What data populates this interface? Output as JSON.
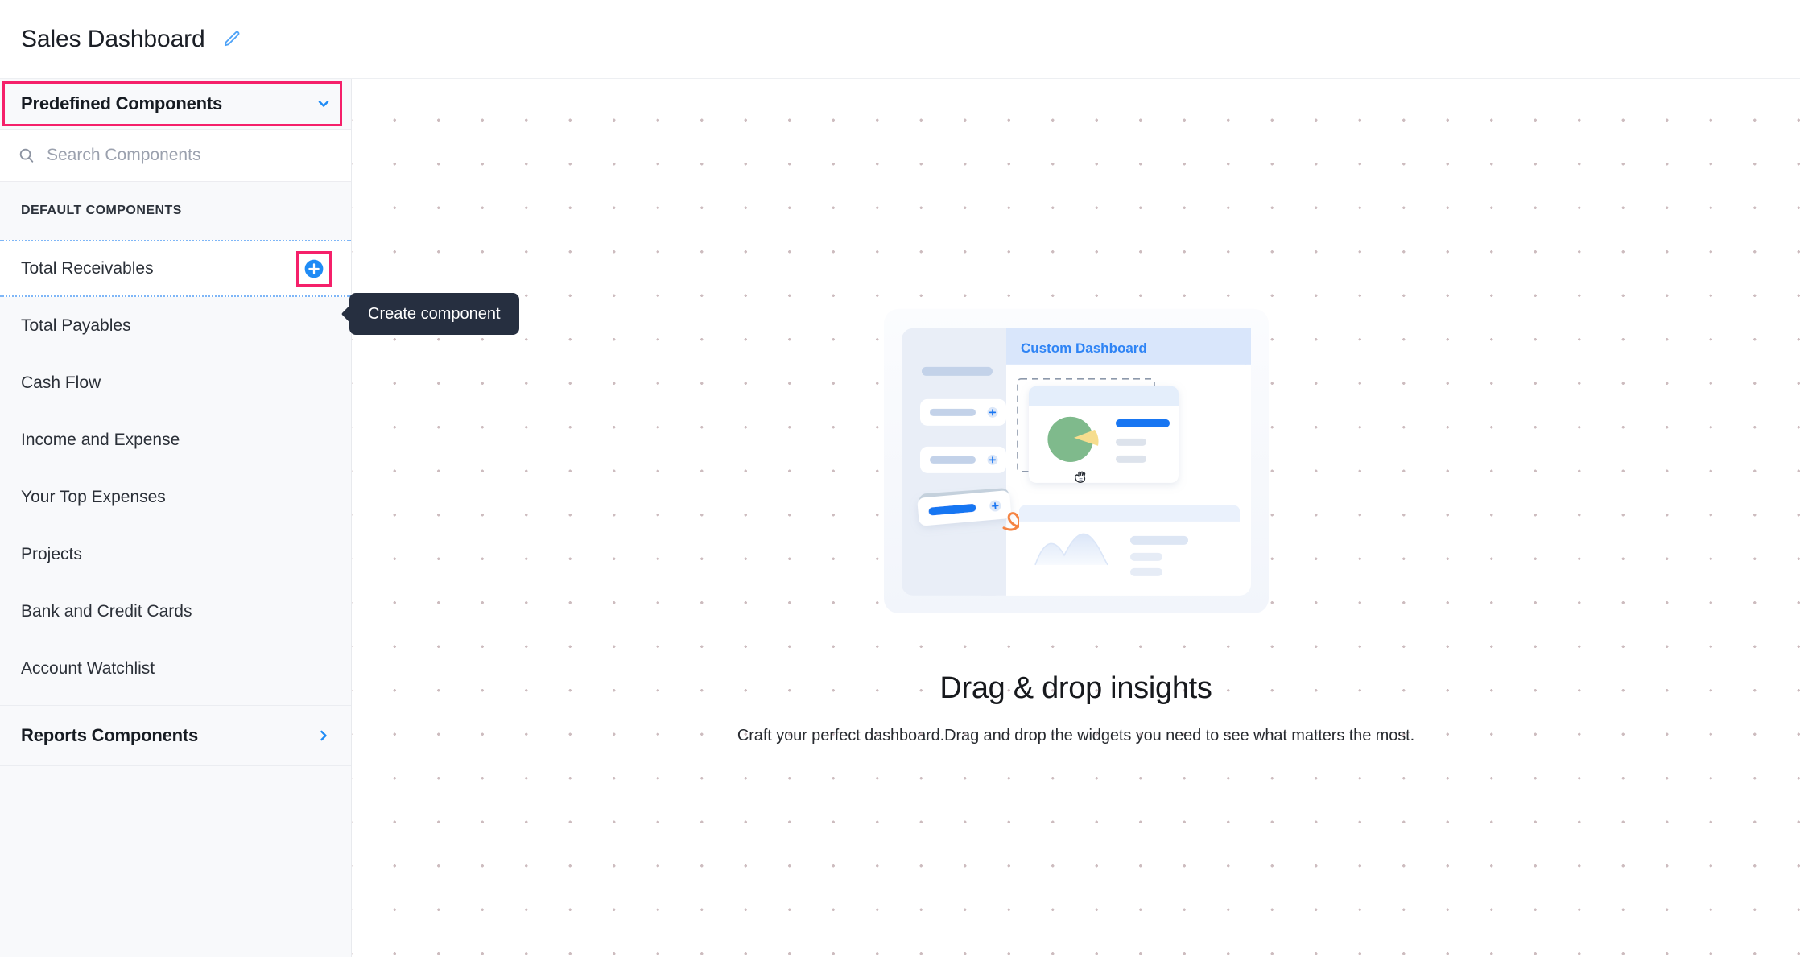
{
  "header": {
    "title": "Sales Dashboard",
    "edit_icon": "pencil-icon"
  },
  "sidebar": {
    "panel": {
      "label": "Predefined Components",
      "chevron_icon": "chevron-down-icon",
      "highlight_color": "#f5206a",
      "expanded": true
    },
    "search": {
      "placeholder": "Search Components",
      "value": "",
      "icon": "search-icon"
    },
    "section_label": "DEFAULT COMPONENTS",
    "items": [
      {
        "label": "Total Receivables",
        "active": true,
        "add_icon": "plus-circle-icon"
      },
      {
        "label": "Total Payables",
        "active": false
      },
      {
        "label": "Cash Flow",
        "active": false
      },
      {
        "label": "Income and Expense",
        "active": false
      },
      {
        "label": "Your Top Expenses",
        "active": false
      },
      {
        "label": "Projects",
        "active": false
      },
      {
        "label": "Bank and Credit Cards",
        "active": false
      },
      {
        "label": "Account Watchlist",
        "active": false
      }
    ],
    "reports": {
      "label": "Reports Components",
      "chevron_icon": "chevron-right-icon",
      "expanded": false
    }
  },
  "tooltip": {
    "text": "Create component",
    "background": "#262f40"
  },
  "canvas": {
    "grid": {
      "dot_color": "#cdbcbf",
      "spacing_px": 54
    },
    "empty_state": {
      "title": "Drag & drop insights",
      "subtitle": "Craft your perfect dashboard.Drag and drop the widgets you need to see what matters the most.",
      "illustration": {
        "name": "drag-drop-dashboard-illustration",
        "panel_title": "Custom Dashboard",
        "panel_title_color": "#2f84f5",
        "pie_colors": [
          "#7fba8c",
          "#f6dd8e"
        ],
        "accent_blue": "#1876f2",
        "arrow_color": "#f58443",
        "cursor_icon": "hand-cursor-icon"
      }
    }
  }
}
